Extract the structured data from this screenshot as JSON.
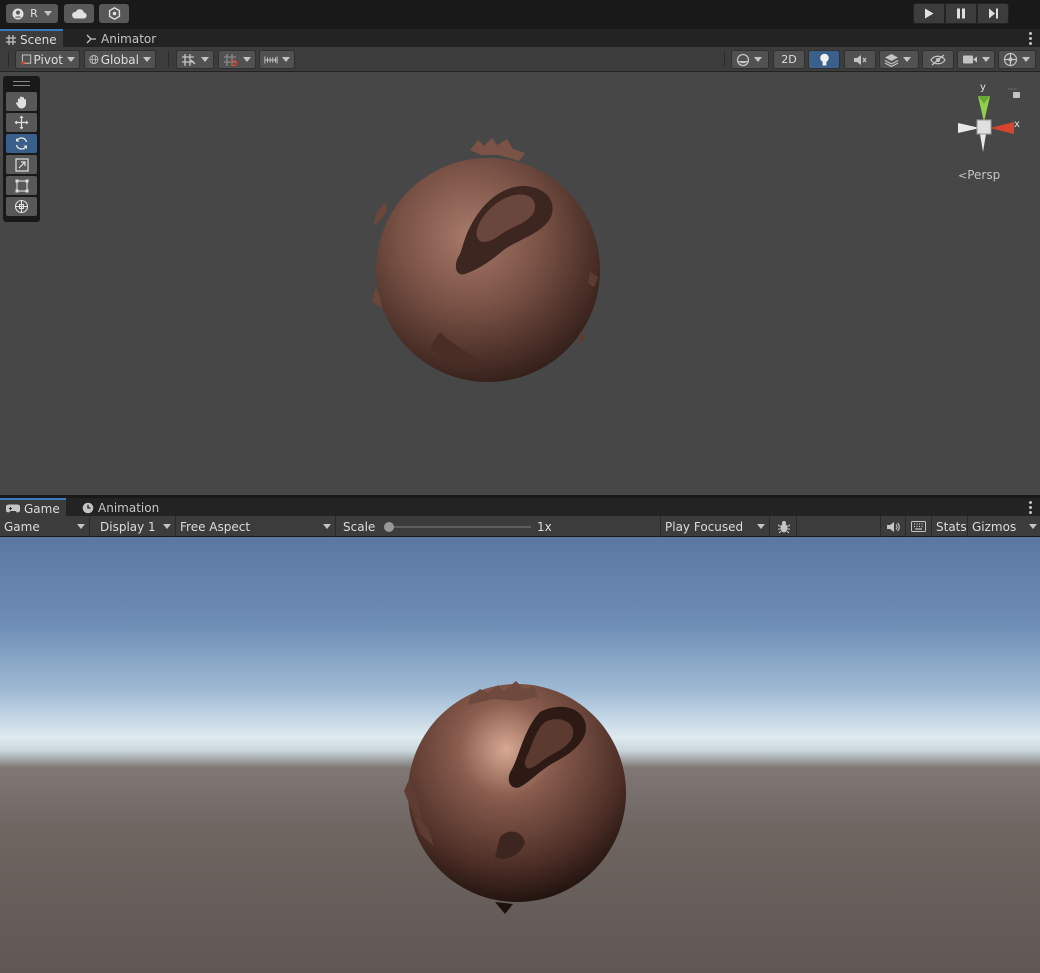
{
  "top_toolbar": {
    "account_label": "R",
    "icons": [
      "user-icon",
      "cloud-icon",
      "settings-icon",
      "play-icon",
      "pause-icon",
      "step-icon"
    ]
  },
  "scene_panel": {
    "tabs": [
      {
        "label": "Scene",
        "icon": "grid-icon",
        "active": true
      },
      {
        "label": "Animator",
        "icon": "animator-icon",
        "active": false
      }
    ],
    "toolbar": {
      "pivot_label": "Pivot",
      "global_label": "Global",
      "mode_2d_label": "2D"
    },
    "tools": [
      "hand-tool",
      "move-tool",
      "rotate-tool",
      "scale-tool",
      "rect-tool",
      "transform-tool"
    ],
    "active_tool": "rotate-tool",
    "gizmo": {
      "y_label": "y",
      "x_label": "x",
      "projection_label": "Persp"
    }
  },
  "game_panel": {
    "tabs": [
      {
        "label": "Game",
        "icon": "gamepad-icon",
        "active": true
      },
      {
        "label": "Animation",
        "icon": "clock-icon",
        "active": false
      }
    ],
    "toolbar": {
      "view_select": "Game",
      "display_select": "Display 1",
      "aspect_select": "Free Aspect",
      "scale_label": "Scale",
      "scale_value": "1x",
      "scale_fraction": 0.0,
      "play_mode_select": "Play Focused",
      "stats_label": "Stats",
      "gizmos_label": "Gizmos"
    }
  },
  "colors": {
    "accent": "#3a79bb",
    "active_tool": "#3a5f8a",
    "sphere": "#7a5246",
    "axis_x": "#d9432f",
    "axis_y": "#8fd14f"
  }
}
